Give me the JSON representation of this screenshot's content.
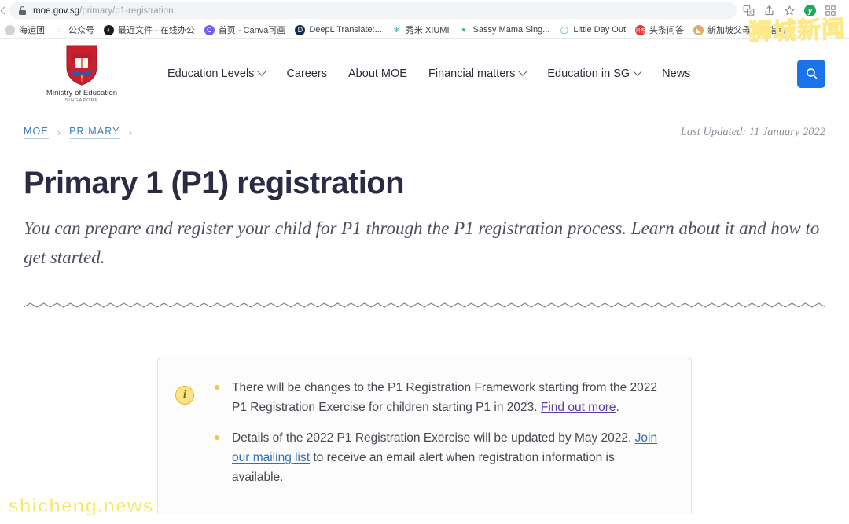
{
  "browser": {
    "url_host": "moe.gov.sg",
    "url_path": "/primary/p1-registration",
    "lock_icon": "lock-icon",
    "back_icon": "back-arrow-icon",
    "toolbar_icons": [
      {
        "name": "translate-icon"
      },
      {
        "name": "share-icon"
      },
      {
        "name": "bookmark-star-icon"
      },
      {
        "name": "extension-avatar-icon",
        "label": "y"
      },
      {
        "name": "extensions-icon"
      }
    ],
    "bookmarks": [
      {
        "label": "海运团",
        "favicon": "shipping-favicon",
        "color": "#cfd3d6",
        "glyph": ""
      },
      {
        "label": "公众号",
        "favicon": "wechat-official-favicon",
        "color": "#ffffff",
        "glyph": "◌"
      },
      {
        "label": "最近文件 - 在线办公",
        "favicon": "recent-files-favicon",
        "color": "#1b1b1b",
        "glyph": "◐"
      },
      {
        "label": "首页 - Canva可画",
        "favicon": "canva-favicon",
        "color": "#7a5cf0",
        "glyph": "C"
      },
      {
        "label": "DeepL Translate:...",
        "favicon": "deepl-favicon",
        "color": "#0f2b46",
        "glyph": "D"
      },
      {
        "label": "秀米 XIUMI",
        "favicon": "xiumi-favicon",
        "color": "#ffffff",
        "glyph": "✻"
      },
      {
        "label": "Sassy Mama Sing...",
        "favicon": "sassy-mama-favicon",
        "color": "#ffffff",
        "glyph": "♥"
      },
      {
        "label": "Little Day Out",
        "favicon": "little-day-out-favicon",
        "color": "#ffffff",
        "glyph": "◯"
      },
      {
        "label": "头条问答",
        "favicon": "toutiao-favicon",
        "color": "#e8322a",
        "glyph": "问答"
      },
      {
        "label": "新加坡父母育儿指南",
        "favicon": "parenting-guide-favicon",
        "color": "#e5a867",
        "glyph": "◣"
      }
    ]
  },
  "site": {
    "logo": {
      "icon": "moe-crest-icon",
      "name": "Ministry of Education",
      "subtitle": "SINGAPORE"
    },
    "nav": [
      {
        "label": "Education Levels",
        "has_dropdown": true
      },
      {
        "label": "Careers",
        "has_dropdown": false
      },
      {
        "label": "About MOE",
        "has_dropdown": false
      },
      {
        "label": "Financial matters",
        "has_dropdown": true
      },
      {
        "label": "Education in SG",
        "has_dropdown": true
      },
      {
        "label": "News",
        "has_dropdown": false
      }
    ],
    "search_button": {
      "icon": "search-icon",
      "color": "#1a73e8"
    }
  },
  "breadcrumb": {
    "items": [
      "MOE",
      "PRIMARY"
    ],
    "separator": "›"
  },
  "last_updated": "Last Updated: 11 January 2022",
  "main": {
    "title": "Primary 1 (P1) registration",
    "lede": "You can prepare and register your child for P1 through the P1 registration process. Learn about it and how to get started.",
    "divider": "zigzag-divider"
  },
  "callout": {
    "icon": "info-icon",
    "icon_glyph": "i",
    "bullets": [
      {
        "segments": [
          {
            "text": "There will be changes to the P1 Registration Framework starting from the 2022 P1 Registration Exercise for children starting P1 in 2023. ",
            "type": "text"
          },
          {
            "text": "Find out more",
            "type": "link-visited"
          },
          {
            "text": ".",
            "type": "text"
          }
        ]
      },
      {
        "segments": [
          {
            "text": "Details of the 2022 P1 Registration Exercise will be updated by May 2022. ",
            "type": "text"
          },
          {
            "text": "Join our mailing list",
            "type": "link"
          },
          {
            "text": " to receive an email alert when registration information is available.",
            "type": "text"
          }
        ]
      }
    ]
  },
  "watermarks": {
    "latin": "shicheng.news",
    "cjk": "狮城新闻"
  },
  "colors": {
    "accent_blue": "#1a73e8",
    "crumb_blue": "#3d7ebd",
    "heading": "#2b2b44",
    "info_yellow": "#efc84a",
    "link": "#2f6fb5",
    "link_visited": "#5b3fa8",
    "crest_red": "#c8202e"
  }
}
